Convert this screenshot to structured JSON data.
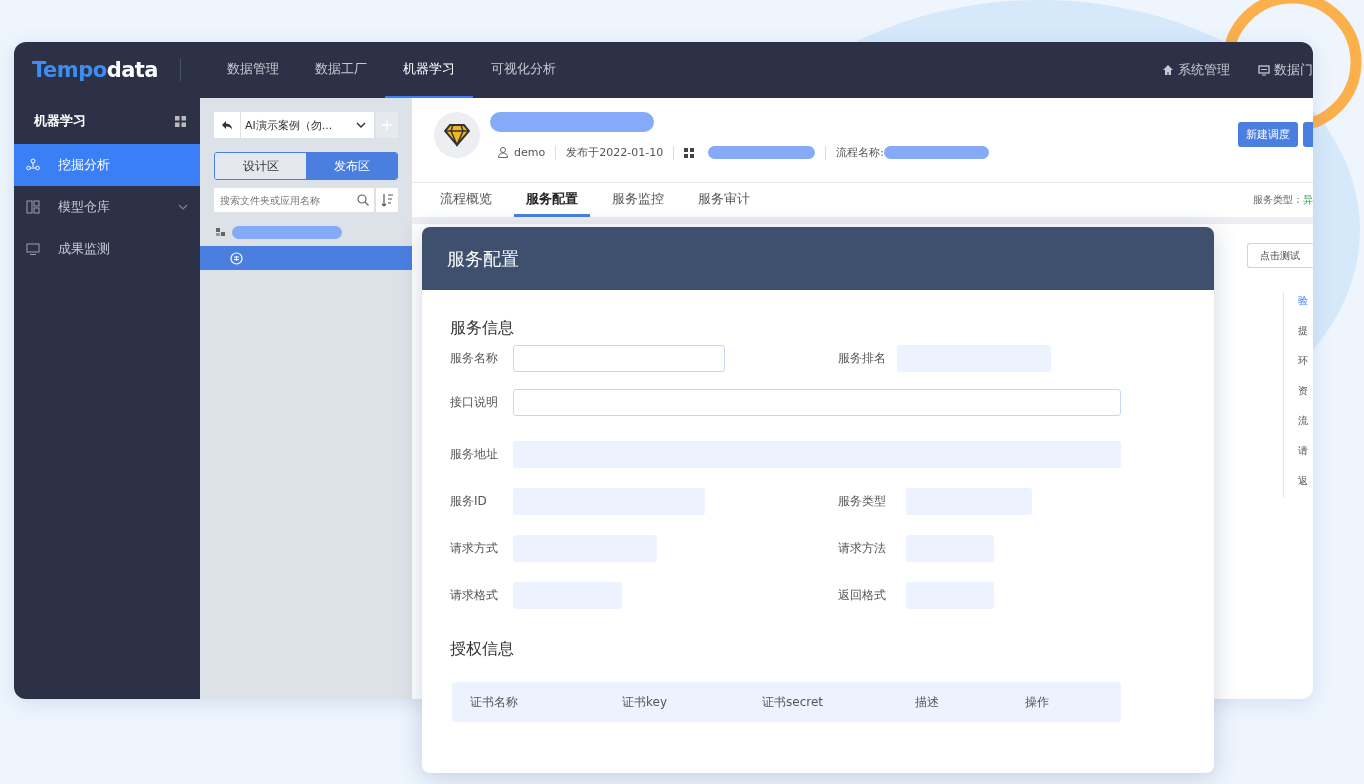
{
  "topbar": {
    "logo": {
      "primary": "Tempo",
      "secondary": "data"
    },
    "nav": [
      {
        "label": "数据管理",
        "selected": false
      },
      {
        "label": "数据工厂",
        "selected": false
      },
      {
        "label": "机器学习",
        "selected": true
      },
      {
        "label": "可视化分析",
        "selected": false
      }
    ],
    "links": [
      {
        "kind": "home",
        "label": "系统管理"
      },
      {
        "kind": "portal",
        "label": "数据门"
      }
    ]
  },
  "sidebar": {
    "title": "机器学习",
    "items": [
      {
        "kind": "nodes",
        "label": "挖掘分析",
        "selected": true
      },
      {
        "kind": "grid",
        "label": "模型仓库",
        "selected": false,
        "expanded": false
      },
      {
        "kind": "monitor",
        "label": "成果监测",
        "selected": false
      }
    ]
  },
  "tree_panel": {
    "project": "AI演示案例（勿...",
    "segments": [
      {
        "label": "设计区",
        "selected": false
      },
      {
        "label": "发布区",
        "selected": true
      }
    ],
    "search": {
      "placeholder": "搜索文件夹或应用名称"
    },
    "nodes": [
      {
        "kind": "folder",
        "selected": false
      },
      {
        "kind": "service",
        "selected": true
      }
    ]
  },
  "header": {
    "user": "demo",
    "published": "发布于2022-01-10",
    "flow_label": "流程名称:",
    "buttons": [
      {
        "label": "新建调度"
      }
    ]
  },
  "tabs": [
    {
      "label": "流程概览",
      "selected": false
    },
    {
      "label": "服务配置",
      "selected": true
    },
    {
      "label": "服务监控",
      "selected": false
    },
    {
      "label": "服务审计",
      "selected": false
    }
  ],
  "service_type": {
    "label": "服务类型：",
    "value": "异"
  },
  "side": {
    "test_button": "点击测试",
    "outline": [
      {
        "label": "验",
        "selected": true
      },
      {
        "label": "提",
        "selected": false
      },
      {
        "label": "环",
        "selected": false
      },
      {
        "label": "资",
        "selected": false
      },
      {
        "label": "流",
        "selected": false
      },
      {
        "label": "请",
        "selected": false
      },
      {
        "label": "返",
        "selected": false
      }
    ]
  },
  "dialog": {
    "title": "服务配置",
    "service_info": {
      "title": "服务信息",
      "rows": [
        [
          {
            "label": "服务名称",
            "kind": "input"
          },
          {
            "label": "服务排名",
            "kind": "readonly"
          }
        ],
        [
          {
            "label": "接口说明",
            "kind": "input"
          }
        ],
        [
          {
            "label": "服务地址",
            "kind": "readonly"
          }
        ],
        [
          {
            "label": "服务ID",
            "kind": "readonly"
          },
          {
            "label": "服务类型",
            "kind": "readonly"
          }
        ],
        [
          {
            "label": "请求方式",
            "kind": "readonly"
          },
          {
            "label": "请求方法",
            "kind": "readonly"
          }
        ],
        [
          {
            "label": "请求格式",
            "kind": "readonly"
          },
          {
            "label": "返回格式",
            "kind": "readonly"
          }
        ]
      ]
    },
    "auth_info": {
      "title": "授权信息",
      "columns": [
        "证书名称",
        "证书key",
        "证书secret",
        "描述",
        "操作"
      ]
    }
  }
}
